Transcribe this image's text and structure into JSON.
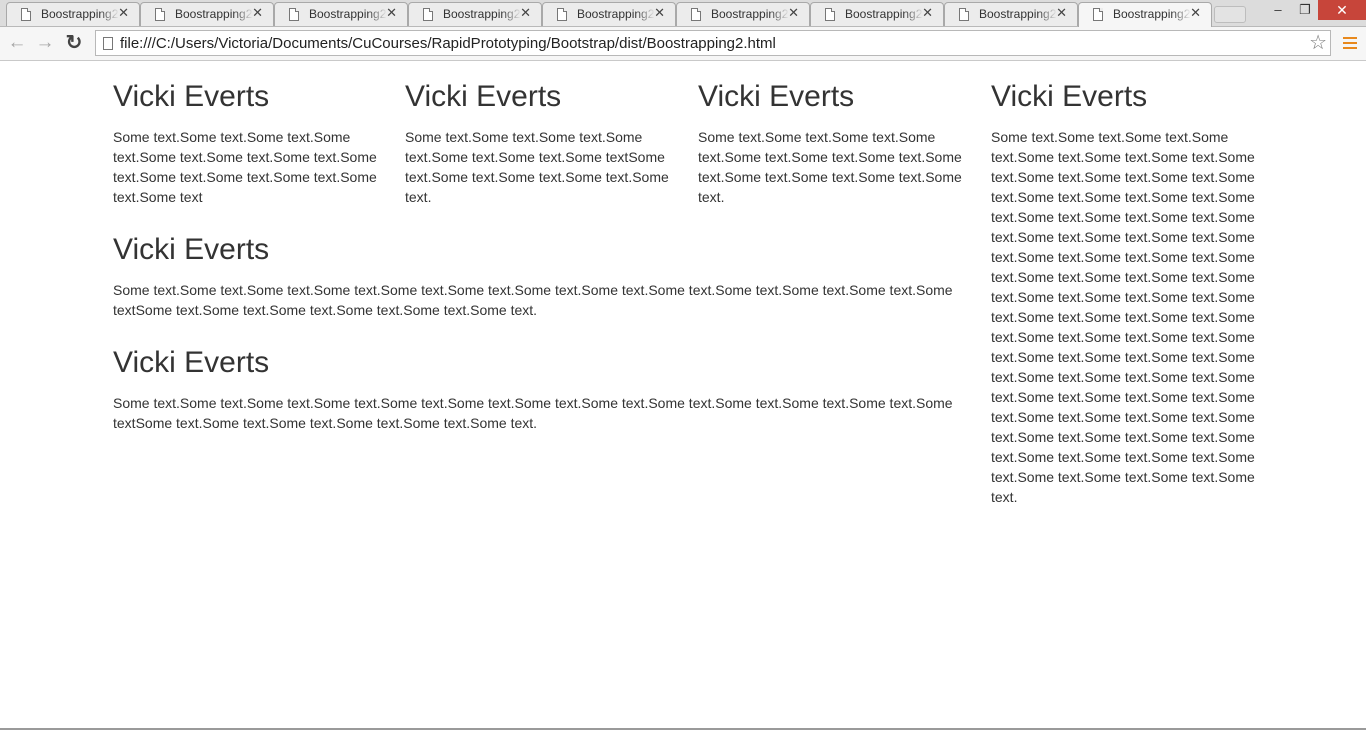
{
  "browser": {
    "tabs": [
      {
        "title": "Boostrapping2."
      },
      {
        "title": "Boostrapping2."
      },
      {
        "title": "Boostrapping2."
      },
      {
        "title": "Boostrapping2."
      },
      {
        "title": "Boostrapping2."
      },
      {
        "title": "Boostrapping2."
      },
      {
        "title": "Boostrapping2."
      },
      {
        "title": "Boostrapping2."
      },
      {
        "title": "Boostrapping2."
      }
    ],
    "tab_close_glyph": "✕",
    "active_tab_index": 8,
    "window_controls": {
      "minimize": "–",
      "maximize": "❐",
      "close": "✕"
    },
    "address_bar": {
      "url": "file:///C:/Users/Victoria/Documents/CuCourses/RapidPrototyping/Bootstrap/dist/Boostrapping2.html"
    },
    "icons": {
      "back": "back-arrow-icon",
      "forward": "forward-arrow-icon",
      "reload": "reload-icon",
      "page": "page-icon",
      "bookmark": "star-icon",
      "menu": "hamburger-menu-icon"
    },
    "glyphs": {
      "back": "←",
      "forward": "→",
      "reload": "↻",
      "star": "☆"
    },
    "accent_color": "#e8891d"
  },
  "page": {
    "blocks": [
      {
        "heading": "Vicki Everts",
        "text": "Some text.Some text.Some text.Some text.Some text.Some text.Some text.Some text.Some text.Some text.Some text.Some text.Some text"
      },
      {
        "heading": "Vicki Everts",
        "text": "Some text.Some text.Some text.Some text.Some text.Some text.Some textSome text.Some text.Some text.Some text.Some text."
      },
      {
        "heading": "Vicki Everts",
        "text": "Some text.Some text.Some text.Some text.Some text.Some text.Some text.Some text.Some text.Some text.Some text.Some text."
      },
      {
        "heading": "Vicki Everts",
        "text": "Some text.Some text.Some text.Some text.Some text.Some text.Some text.Some text.Some text.Some text.Some text.Some text.Some text.Some text.Some text.Some text.Some text.Some text.Some text.Some text.Some text.Some text.Some text.Some text.Some text.Some text.Some text.Some text.Some text.Some text.Some text.Some text.Some text.Some text.Some text.Some text.Some text.Some text.Some text.Some text.Some text.Some text.Some text.Some text.Some text.Some text.Some text.Some text.Some text.Some text.Some text.Some text.Some text.Some text.Some text.Some text.Some text.Some text.Some text.Some text.Some text.Some text.Some text.Some text.Some text.Some text.Some text.Some text.Some text.Some text.Some text.Some text."
      },
      {
        "heading": "Vicki Everts",
        "text": "Some text.Some text.Some text.Some text.Some text.Some text.Some text.Some text.Some text.Some text.Some text.Some text.Some textSome text.Some text.Some text.Some text.Some text.Some text."
      },
      {
        "heading": "Vicki Everts",
        "text": "Some text.Some text.Some text.Some text.Some text.Some text.Some text.Some text.Some text.Some text.Some text.Some text.Some textSome text.Some text.Some text.Some text.Some text.Some text."
      }
    ]
  }
}
